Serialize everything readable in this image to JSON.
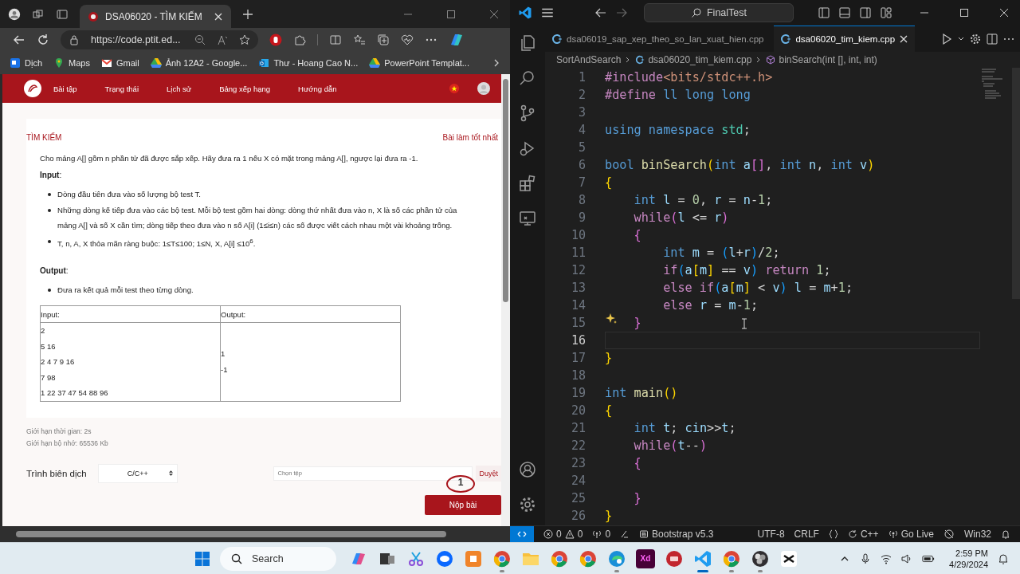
{
  "browser": {
    "tab_title": "DSA06020 - TÌM KIẾM",
    "url": "https://code.ptit.ed...",
    "bookmarks": [
      {
        "label": "Dịch",
        "kind": "translate"
      },
      {
        "label": "Maps",
        "kind": "maps"
      },
      {
        "label": "Gmail",
        "kind": "mail"
      },
      {
        "label": "Ảnh 12A2 - Google...",
        "kind": "drive"
      },
      {
        "label": "Thư - Hoang Cao N...",
        "kind": "outlook"
      },
      {
        "label": "PowerPoint Templat...",
        "kind": "drive"
      }
    ]
  },
  "site": {
    "nav": [
      "Bài tập",
      "Trạng thái",
      "Lịch sử",
      "Bảng xếp hạng",
      "Hướng dẫn"
    ],
    "problem_title": "TÌM KIẾM",
    "best_link": "Bài làm tốt nhất",
    "statement": "Cho mảng A[] gồm n phần tử đã được sắp xếp. Hãy đưa ra 1 nếu X có mặt trong mảng A[], ngược lại đưa ra -1.",
    "input_heading": "**Input**:",
    "input_items": [
      "Dòng đầu tiên đưa vào số lượng bộ test T.",
      "Những dòng kế tiếp đưa vào các bộ test. Mỗi bộ test gồm hai dòng: dòng thứ nhất đưa vào n, X là số các phần tử của mảng A[] và số X cần tìm; dòng tiếp theo đưa vào n số A[i] (1≤i≤n) các số được viết cách nhau một vài khoảng trống.",
      "T, n, A, X thỏa mãn ràng buộc: 1≤T≤100; 1≤N, X, A[i] ≤10$^{6}$."
    ],
    "output_heading": "**Output**:",
    "output_items": [
      "Đưa ra kết quả mỗi test theo từng dòng."
    ],
    "example": {
      "columns": [
        "Input:",
        "Output:"
      ],
      "input_lines": [
        "2",
        "5 16",
        "2 4 7 9 16",
        "7 98",
        "1 22 37 47 54 88 96"
      ],
      "output_lines": [
        "1",
        "-1"
      ]
    },
    "limits": [
      "Giới hạn thời gian: 2s",
      "Giới hạn bộ nhớ: 65536 Kb"
    ],
    "compiler_label": "Trình biên dịch",
    "compiler_value": "C/C++",
    "file_placeholder": "Chọn tệp",
    "browse_button": "Duyệt",
    "submit_button": "Nộp bài",
    "annotation": "1"
  },
  "editor": {
    "search": "FinalTest",
    "tabs": [
      {
        "label": "dsa06019_sap_xep_theo_so_lan_xuat_hien.cpp",
        "selected": false
      },
      {
        "label": "dsa06020_tim_kiem.cpp",
        "selected": true
      }
    ],
    "breadcrumbs": [
      "SortAndSearch",
      "dsa06020_tim_kiem.cpp",
      "binSearch(int [], int, int)"
    ],
    "lines": [
      {
        "number": "1",
        "current": false,
        "tokens": [
          {
            "text": "#include",
            "kind": "directive"
          },
          {
            "text": "<bits/stdc++.h>",
            "kind": "string"
          }
        ]
      },
      {
        "number": "2",
        "current": false,
        "tokens": [
          {
            "text": "#define",
            "kind": "directive"
          },
          {
            "text": " ll long long",
            "kind": "keyword"
          }
        ]
      },
      {
        "number": "3",
        "current": false
      },
      {
        "number": "4",
        "current": false,
        "tokens": [
          {
            "text": "using namespace",
            "kind": "keyword"
          },
          {
            "text": " std",
            "kind": "type"
          },
          {
            "text": ";",
            "kind": "plain"
          }
        ]
      },
      {
        "number": "5",
        "current": false
      },
      {
        "number": "6",
        "current": false,
        "tokens": [
          {
            "text": "bool",
            "kind": "keyword"
          },
          {
            "text": " binSearch",
            "kind": "function"
          },
          {
            "text": "(",
            "kind": "bracket1"
          },
          {
            "text": "int",
            "kind": "keyword"
          },
          {
            "text": " a",
            "kind": "variable"
          },
          {
            "text": "[]",
            "kind": "bracket2"
          },
          {
            "text": ", ",
            "kind": "plain"
          },
          {
            "text": "int",
            "kind": "keyword"
          },
          {
            "text": " n",
            "kind": "variable"
          },
          {
            "text": ", ",
            "kind": "plain"
          },
          {
            "text": "int",
            "kind": "keyword"
          },
          {
            "text": " v",
            "kind": "variable"
          },
          {
            "text": ")",
            "kind": "bracket1"
          }
        ]
      },
      {
        "number": "7",
        "current": false,
        "tokens": [
          {
            "text": "{",
            "kind": "bracket1"
          }
        ]
      },
      {
        "number": "8",
        "current": false,
        "tokens": [
          {
            "text": "    int",
            "kind": "keyword"
          },
          {
            "text": " l",
            "kind": "variable"
          },
          {
            "text": " = ",
            "kind": "plain"
          },
          {
            "text": "0",
            "kind": "number"
          },
          {
            "text": ", ",
            "kind": "plain"
          },
          {
            "text": "r",
            "kind": "variable"
          },
          {
            "text": " = ",
            "kind": "plain"
          },
          {
            "text": "n",
            "kind": "variable"
          },
          {
            "text": "-",
            "kind": "plain"
          },
          {
            "text": "1",
            "kind": "number"
          },
          {
            "text": ";",
            "kind": "plain"
          }
        ]
      },
      {
        "number": "9",
        "current": false,
        "tokens": [
          {
            "text": "    while",
            "kind": "control"
          },
          {
            "text": "(",
            "kind": "bracket2"
          },
          {
            "text": "l",
            "kind": "variable"
          },
          {
            "text": " <= ",
            "kind": "plain"
          },
          {
            "text": "r",
            "kind": "variable"
          },
          {
            "text": ")",
            "kind": "bracket2"
          }
        ]
      },
      {
        "number": "10",
        "current": false,
        "tokens": [
          {
            "text": "    {",
            "kind": "bracket2"
          }
        ]
      },
      {
        "number": "11",
        "current": false,
        "tokens": [
          {
            "text": "        int",
            "kind": "keyword"
          },
          {
            "text": " m",
            "kind": "variable"
          },
          {
            "text": " = ",
            "kind": "plain"
          },
          {
            "text": "(",
            "kind": "bracket3"
          },
          {
            "text": "l",
            "kind": "variable"
          },
          {
            "text": "+",
            "kind": "plain"
          },
          {
            "text": "r",
            "kind": "variable"
          },
          {
            "text": ")",
            "kind": "bracket3"
          },
          {
            "text": "/",
            "kind": "plain"
          },
          {
            "text": "2",
            "kind": "number"
          },
          {
            "text": ";",
            "kind": "plain"
          }
        ]
      },
      {
        "number": "12",
        "current": false,
        "tokens": [
          {
            "text": "        if",
            "kind": "control"
          },
          {
            "text": "(",
            "kind": "bracket3"
          },
          {
            "text": "a",
            "kind": "variable"
          },
          {
            "text": "[",
            "kind": "bracket1"
          },
          {
            "text": "m",
            "kind": "variable"
          },
          {
            "text": "]",
            "kind": "bracket1"
          },
          {
            "text": " == ",
            "kind": "plain"
          },
          {
            "text": "v",
            "kind": "variable"
          },
          {
            "text": ")",
            "kind": "bracket3"
          },
          {
            "text": " return",
            "kind": "control"
          },
          {
            "text": " 1",
            "kind": "number"
          },
          {
            "text": ";",
            "kind": "plain"
          }
        ]
      },
      {
        "number": "13",
        "current": false,
        "tokens": [
          {
            "text": "        else if",
            "kind": "control"
          },
          {
            "text": "(",
            "kind": "bracket3"
          },
          {
            "text": "a",
            "kind": "variable"
          },
          {
            "text": "[",
            "kind": "bracket1"
          },
          {
            "text": "m",
            "kind": "variable"
          },
          {
            "text": "]",
            "kind": "bracket1"
          },
          {
            "text": " < ",
            "kind": "plain"
          },
          {
            "text": "v",
            "kind": "variable"
          },
          {
            "text": ")",
            "kind": "bracket3"
          },
          {
            "text": " l",
            "kind": "variable"
          },
          {
            "text": " = ",
            "kind": "plain"
          },
          {
            "text": "m",
            "kind": "variable"
          },
          {
            "text": "+",
            "kind": "plain"
          },
          {
            "text": "1",
            "kind": "number"
          },
          {
            "text": ";",
            "kind": "plain"
          }
        ]
      },
      {
        "number": "14",
        "current": false,
        "tokens": [
          {
            "text": "        else",
            "kind": "control"
          },
          {
            "text": " r",
            "kind": "variable"
          },
          {
            "text": " = ",
            "kind": "plain"
          },
          {
            "text": "m",
            "kind": "variable"
          },
          {
            "text": "-",
            "kind": "plain"
          },
          {
            "text": "1",
            "kind": "number"
          },
          {
            "text": ";",
            "kind": "plain"
          }
        ]
      },
      {
        "number": "15",
        "current": false,
        "tokens": [
          {
            "text": "    }",
            "kind": "bracket2"
          }
        ]
      },
      {
        "number": "16",
        "current": true
      },
      {
        "number": "17",
        "current": false,
        "tokens": [
          {
            "text": "}",
            "kind": "bracket1"
          }
        ]
      },
      {
        "number": "18",
        "current": false
      },
      {
        "number": "19",
        "current": false,
        "tokens": [
          {
            "text": "int",
            "kind": "keyword"
          },
          {
            "text": " main",
            "kind": "function"
          },
          {
            "text": "()",
            "kind": "bracket1"
          }
        ]
      },
      {
        "number": "20",
        "current": false,
        "tokens": [
          {
            "text": "{",
            "kind": "bracket1"
          }
        ]
      },
      {
        "number": "21",
        "current": false,
        "tokens": [
          {
            "text": "    int",
            "kind": "keyword"
          },
          {
            "text": " t",
            "kind": "variable"
          },
          {
            "text": "; ",
            "kind": "plain"
          },
          {
            "text": "cin",
            "kind": "variable"
          },
          {
            "text": ">>",
            "kind": "plain"
          },
          {
            "text": "t",
            "kind": "variable"
          },
          {
            "text": ";",
            "kind": "plain"
          }
        ]
      },
      {
        "number": "22",
        "current": false,
        "tokens": [
          {
            "text": "    while",
            "kind": "control"
          },
          {
            "text": "(",
            "kind": "bracket2"
          },
          {
            "text": "t",
            "kind": "variable"
          },
          {
            "text": "--",
            "kind": "plain"
          },
          {
            "text": ")",
            "kind": "bracket2"
          }
        ]
      },
      {
        "number": "23",
        "current": false,
        "tokens": [
          {
            "text": "    {",
            "kind": "bracket2"
          }
        ]
      },
      {
        "number": "24",
        "current": false
      },
      {
        "number": "25",
        "current": false,
        "tokens": [
          {
            "text": "    }",
            "kind": "bracket2"
          }
        ]
      },
      {
        "number": "26",
        "current": false,
        "tokens": [
          {
            "text": "}",
            "kind": "bracket1"
          }
        ]
      }
    ],
    "status": {
      "errors": "0",
      "warnings": "0",
      "ports": "0",
      "bootstrap": "Bootstrap v5.3",
      "encoding": "UTF-8",
      "eol": "CRLF",
      "language": "C++",
      "live": "Go Live",
      "platform": "Win32"
    }
  },
  "taskbar": {
    "search_placeholder": "Search",
    "apps": [
      {
        "kind": "copilot",
        "running": false
      },
      {
        "kind": "taskview",
        "running": false
      },
      {
        "kind": "snip",
        "running": false
      },
      {
        "kind": "chat",
        "running": false
      },
      {
        "kind": "orange",
        "running": false
      },
      {
        "kind": "browser",
        "running": true
      },
      {
        "kind": "folder",
        "running": false
      },
      {
        "kind": "browser",
        "running": false
      },
      {
        "kind": "browser",
        "running": false
      },
      {
        "kind": "edge",
        "running": true
      },
      {
        "kind": "xd",
        "running": false,
        "label": "Xd"
      },
      {
        "kind": "devcpp",
        "running": false
      },
      {
        "kind": "code",
        "running": true
      },
      {
        "kind": "browser",
        "running": true
      },
      {
        "kind": "recorder",
        "running": true
      },
      {
        "kind": "cut",
        "running": false
      }
    ],
    "time": "2:59 PM",
    "date": "4/29/2024"
  }
}
